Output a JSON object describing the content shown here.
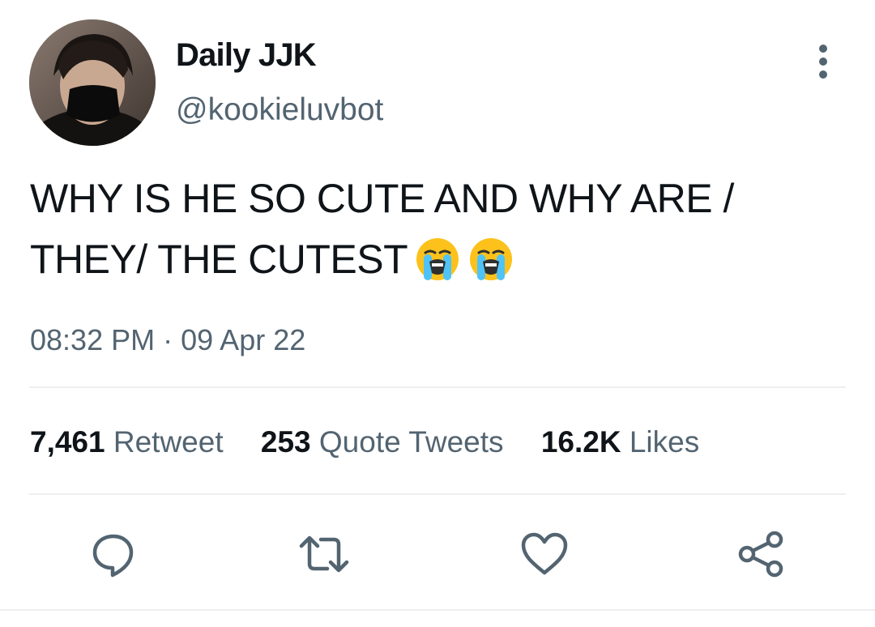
{
  "author": {
    "display_name": "Daily JJK",
    "handle": "@kookieluvbot",
    "avatar": "avatar-photo"
  },
  "tweet": {
    "text_line1": "WHY IS HE SO CUTE AND WHY ARE /",
    "text_line2": "THEY/ THE CUTEST",
    "emojis": [
      "loudly-crying-face-emoji",
      "loudly-crying-face-emoji"
    ],
    "time": "08:32 PM",
    "separator": "·",
    "date": "09 Apr 22"
  },
  "stats": {
    "retweets": {
      "count": "7,461",
      "label": "Retweet"
    },
    "quotes": {
      "count": "253",
      "label": "Quote Tweets"
    },
    "likes": {
      "count": "16.2K",
      "label": "Likes"
    }
  },
  "actions": {
    "icons": [
      "reply-icon",
      "retweet-icon",
      "like-icon",
      "share-icon"
    ]
  },
  "colors": {
    "text": "#0f1419",
    "secondary": "#536471",
    "divider": "#eceef0"
  }
}
